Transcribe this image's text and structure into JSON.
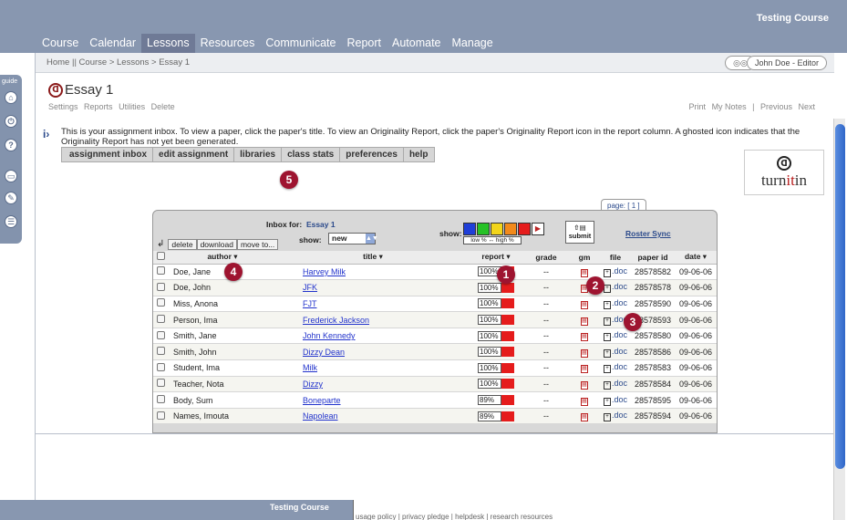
{
  "header": {
    "course_name": "Testing Course",
    "tabs": [
      {
        "label": "Course"
      },
      {
        "label": "Calendar"
      },
      {
        "label": "Lessons",
        "active": true
      },
      {
        "label": "Resources"
      },
      {
        "label": "Communicate"
      },
      {
        "label": "Report"
      },
      {
        "label": "Automate"
      },
      {
        "label": "Manage"
      }
    ]
  },
  "rail": {
    "label": "guide"
  },
  "breadcrumb": "Home || Course > Lessons > Essay 1",
  "user": {
    "name": "John Doe - Editor"
  },
  "page": {
    "title": "Essay 1",
    "subnav": [
      "Settings",
      "Reports",
      "Utilities",
      "Delete"
    ],
    "rightnav": [
      "Print",
      "My Notes",
      "|",
      "Previous",
      "Next"
    ],
    "info_text": "This is your assignment inbox. To view a paper, click the paper's title. To view an Originality Report, click the paper's Originality Report icon in the report column. A ghosted icon indicates that the Originality Report has not yet been generated."
  },
  "subtabs": [
    "assignment inbox",
    "edit assignment",
    "libraries",
    "class stats",
    "preferences",
    "help"
  ],
  "logo": {
    "text_a": "turn",
    "text_b": "it",
    "text_c": "in"
  },
  "badges": [
    "1",
    "2",
    "3",
    "4",
    "5"
  ],
  "inbox": {
    "page_label": "page: [ 1 ]",
    "inbox_for_label": "Inbox for:",
    "inbox_for_value": "Essay 1",
    "show_label": "show:",
    "show_value": "new",
    "colors_label": "show:",
    "scale": {
      "low": "low %",
      "arrow": "↔",
      "high": "high %"
    },
    "color_swatches": [
      "#1f3fd8",
      "#27c227",
      "#f2d51b",
      "#f28a1b",
      "#e51c1c"
    ],
    "submit_label": "submit",
    "roster_sync": "Roster Sync",
    "actions": [
      "delete",
      "download",
      "move to..."
    ],
    "columns": {
      "author": "author",
      "title": "title",
      "report": "report",
      "grade": "grade",
      "gm": "gm",
      "file": "file",
      "paper_id": "paper id",
      "date": "date"
    },
    "rows": [
      {
        "author": "Doe, Jane",
        "title": "Harvey Milk",
        "report": "100%",
        "grade": "--",
        "file": ".doc",
        "paper_id": "28578582",
        "date": "09-06-06"
      },
      {
        "author": "Doe, John",
        "title": "JFK",
        "report": "100%",
        "grade": "--",
        "file": ".doc",
        "paper_id": "28578578",
        "date": "09-06-06"
      },
      {
        "author": "Miss, Anona",
        "title": "FJT",
        "report": "100%",
        "grade": "--",
        "file": ".doc",
        "paper_id": "28578590",
        "date": "09-06-06"
      },
      {
        "author": "Person, Ima",
        "title": "Frederick Jackson",
        "report": "100%",
        "grade": "--",
        "file": ".doc",
        "paper_id": "28578593",
        "date": "09-06-06"
      },
      {
        "author": "Smith, Jane",
        "title": "John Kennedy",
        "report": "100%",
        "grade": "--",
        "file": ".doc",
        "paper_id": "28578580",
        "date": "09-06-06"
      },
      {
        "author": "Smith, John",
        "title": "Dizzy Dean",
        "report": "100%",
        "grade": "--",
        "file": ".doc",
        "paper_id": "28578586",
        "date": "09-06-06"
      },
      {
        "author": "Student, Ima",
        "title": "Milk",
        "report": "100%",
        "grade": "--",
        "file": ".doc",
        "paper_id": "28578583",
        "date": "09-06-06"
      },
      {
        "author": "Teacher, Nota",
        "title": "Dizzy",
        "report": "100%",
        "grade": "--",
        "file": ".doc",
        "paper_id": "28578584",
        "date": "09-06-06"
      },
      {
        "author": "Body, Sum",
        "title": "Boneparte",
        "report": "89%",
        "grade": "--",
        "file": ".doc",
        "paper_id": "28578595",
        "date": "09-06-06"
      },
      {
        "author": "Names, Imouta",
        "title": "Napolean",
        "report": "89%",
        "grade": "--",
        "file": ".doc",
        "paper_id": "28578594",
        "date": "09-06-06"
      }
    ]
  },
  "bottom_window": {
    "title": "Testing Course",
    "footer": "usage policy | privacy pledge | helpdesk | research resources"
  }
}
